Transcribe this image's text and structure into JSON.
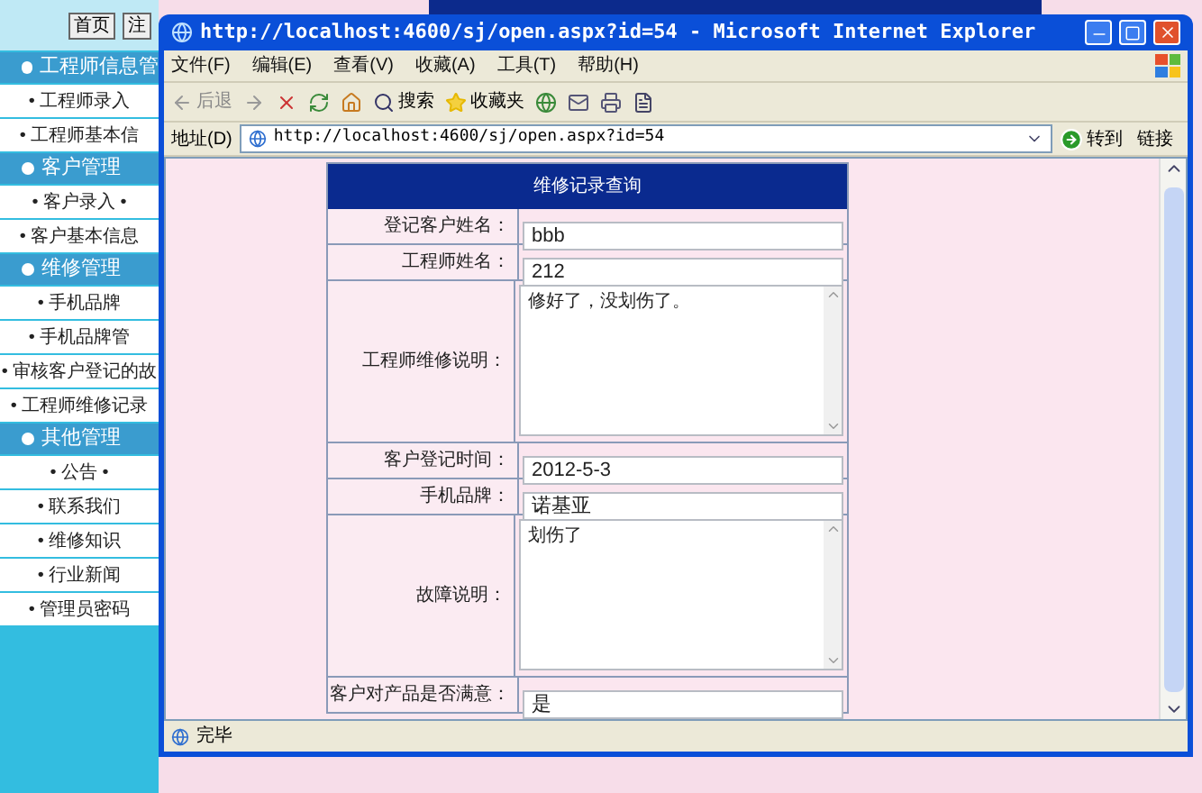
{
  "page": {
    "top_buttons": [
      "首页",
      "注"
    ],
    "sidebar": [
      {
        "title": "工程师信息管",
        "items": [
          "• 工程师录入",
          "• 工程师基本信"
        ]
      },
      {
        "title": "客户管理",
        "items": [
          "• 客户录入 •",
          "• 客户基本信息"
        ]
      },
      {
        "title": "维修管理",
        "items": [
          "• 手机品牌",
          "• 手机品牌管",
          "• 审核客户登记的故",
          "• 工程师维修记录"
        ]
      },
      {
        "title": "其他管理",
        "items": [
          "• 公告 •",
          "• 联系我们",
          "• 维修知识",
          "• 行业新闻",
          "• 管理员密码"
        ]
      }
    ]
  },
  "browser": {
    "title": "http://localhost:4600/sj/open.aspx?id=54 - Microsoft Internet Explorer",
    "menu": [
      "文件(F)",
      "编辑(E)",
      "查看(V)",
      "收藏(A)",
      "工具(T)",
      "帮助(H)"
    ],
    "toolbar": {
      "back": "后退",
      "search": "搜索",
      "favorites": "收藏夹"
    },
    "address": {
      "label": "地址(D)",
      "url": "http://localhost:4600/sj/open.aspx?id=54",
      "go": "转到",
      "links": "链接"
    },
    "form": {
      "title": "维修记录查询",
      "rows": [
        {
          "kind": "input",
          "label": "登记客户姓名：",
          "value": "bbb"
        },
        {
          "kind": "input",
          "label": "工程师姓名：",
          "value": "212"
        },
        {
          "kind": "textarea",
          "label": "工程师维修说明：",
          "value": "修好了，没划伤了。"
        },
        {
          "kind": "input",
          "label": "客户登记时间：",
          "value": "2012-5-3"
        },
        {
          "kind": "input",
          "label": "手机品牌：",
          "value": "诺基亚"
        },
        {
          "kind": "textarea",
          "label": "故障说明：",
          "value": "划伤了"
        },
        {
          "kind": "input",
          "label": "客户对产品是否满意：",
          "value": "是"
        }
      ]
    },
    "status": "完毕"
  }
}
